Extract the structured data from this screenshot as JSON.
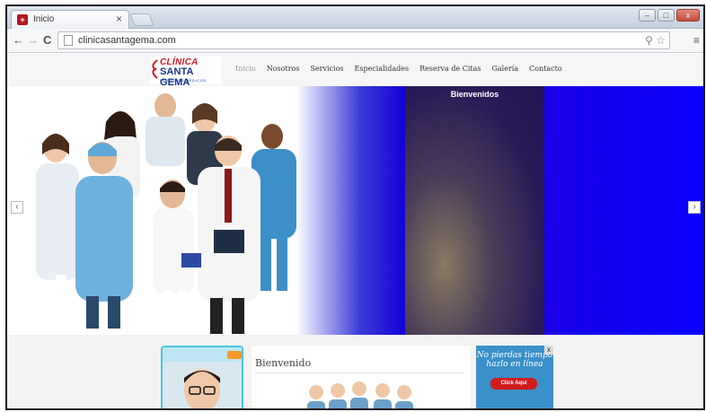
{
  "browser": {
    "tab_title": "Inicio",
    "tab_close": "×",
    "url": "clinicasantagema.com",
    "back": "←",
    "forward": "→",
    "reload": "C",
    "omni_icons": "⚲ ☆",
    "menu": "≡",
    "min": "–",
    "max": "□",
    "close": "x"
  },
  "site": {
    "logo": {
      "line1": "CLÍNICA",
      "line2": "SANTA GEMA",
      "line3": "SERVICIOS MÉDICOS"
    },
    "nav": [
      "Inicio",
      "Nosotros",
      "Servicios",
      "Especialidades",
      "Reserva de Citas",
      "Galería",
      "Contacto"
    ],
    "slider": {
      "title": "Bienvenidos",
      "prev": "‹",
      "next": "›"
    },
    "welcome": {
      "title": "Bienvenido"
    },
    "ad": {
      "text": "No pierdas tiempo hazlo en línea",
      "button": "Click Aquí",
      "close": "x"
    }
  },
  "colors": {
    "logo_red": "#d11a24",
    "logo_blue": "#14358f",
    "slide_blue": "#0a00ff",
    "ad_button": "#d21b1b",
    "promo_border": "#48c6e0"
  }
}
